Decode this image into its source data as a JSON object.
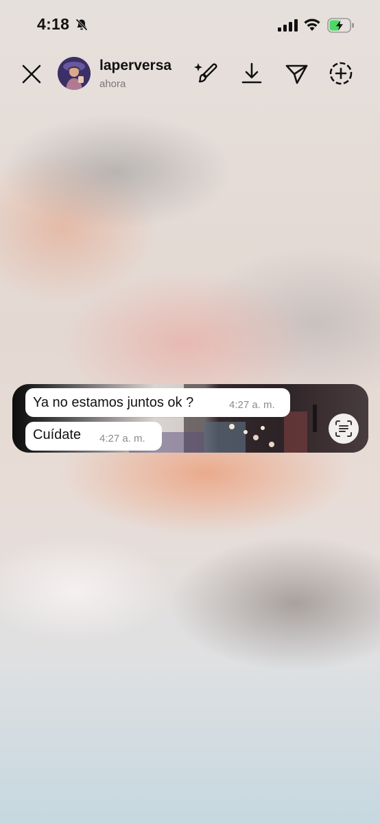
{
  "status_bar": {
    "time": "4:18",
    "icons": [
      "bell-slash-icon",
      "signal-icon",
      "wifi-icon",
      "battery-charging-icon"
    ],
    "battery_color": "#4cd964"
  },
  "header": {
    "username": "laperversa",
    "subtitle": "ahora",
    "icons": [
      "close-icon",
      "sparkle-brush-icon",
      "download-icon",
      "send-icon",
      "add-circle-icon"
    ]
  },
  "messages": [
    {
      "text": "Ya no estamos juntos ok ?",
      "time": "4:27 a. m."
    },
    {
      "text": "Cuídate",
      "time": "4:27 a. m."
    }
  ],
  "scan_button": {
    "icon": "text-scan-icon"
  }
}
